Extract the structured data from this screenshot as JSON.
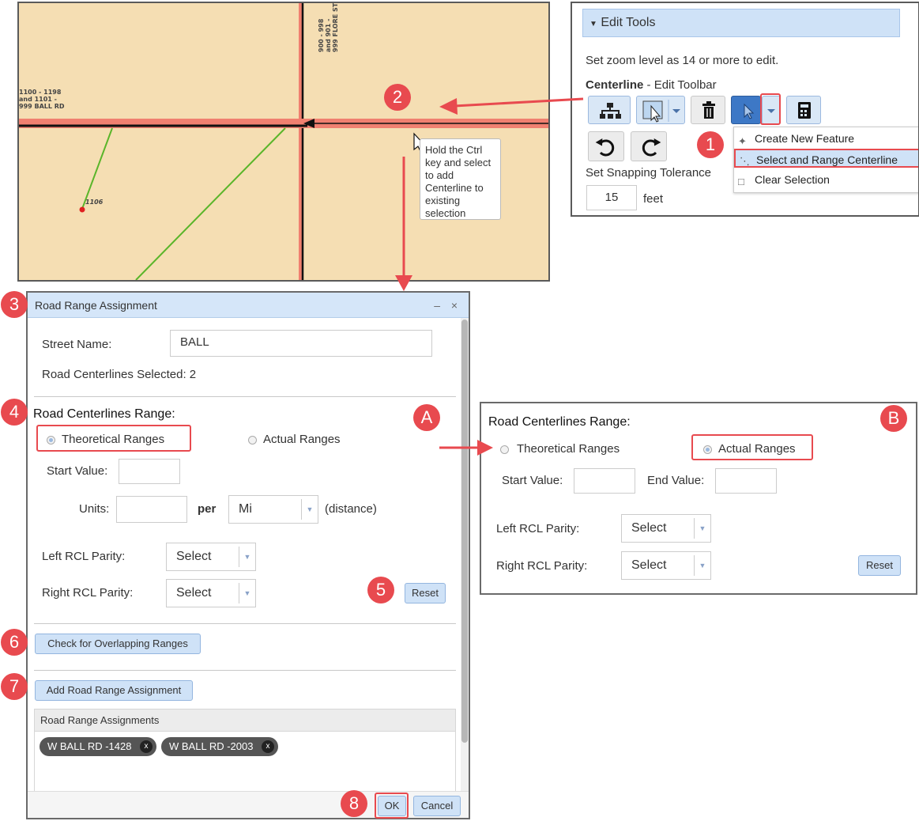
{
  "map": {
    "labels": {
      "ball_range": "1100 - 1198\nand 1101 -\n999 BALL RD",
      "flore_range": "900 - 998\nand 901 -\n999 FLORE ST",
      "point_label": "1106"
    },
    "tooltip": "Hold the Ctrl key and select to add Centerline to existing selection"
  },
  "edit_tools": {
    "header": "Edit Tools",
    "zoom_note": "Set zoom level as 14 or more to edit.",
    "toolbar_title_bold": "Centerline",
    "toolbar_title_rest": " - Edit Toolbar",
    "snap_label": "Set Snapping Tolerance",
    "snap_value": "15",
    "snap_unit": "feet",
    "menu": {
      "create": "Create New Feature",
      "select_range": "Select and Range Centerline",
      "clear": "Clear Selection"
    }
  },
  "dialog": {
    "title": "Road Range Assignment",
    "street_name_label": "Street Name:",
    "street_name_value": "BALL",
    "selected_text": "Road Centerlines Selected: 2",
    "range_heading": "Road Centerlines Range:",
    "radio_theoretical": "Theoretical Ranges",
    "radio_actual": "Actual Ranges",
    "start_value_label": "Start Value:",
    "units_label": "Units:",
    "per_label": "per",
    "units_select": "Mi",
    "distance_label": "(distance)",
    "left_parity_label": "Left RCL Parity:",
    "right_parity_label": "Right RCL Parity:",
    "select_placeholder": "Select",
    "reset_label": "Reset",
    "check_overlap_label": "Check for Overlapping Ranges",
    "add_assignment_label": "Add Road Range Assignment",
    "assignments_header": "Road Range Assignments",
    "assignments": [
      "W BALL RD -1428",
      "W BALL RD -2003"
    ],
    "chip_close": "x",
    "ok_label": "OK",
    "cancel_label": "Cancel"
  },
  "panel_b": {
    "range_heading": "Road Centerlines Range:",
    "radio_theoretical": "Theoretical Ranges",
    "radio_actual": "Actual Ranges",
    "start_value_label": "Start Value:",
    "end_value_label": "End Value:",
    "left_parity_label": "Left RCL Parity:",
    "right_parity_label": "Right RCL Parity:",
    "select_placeholder": "Select",
    "reset_label": "Reset"
  },
  "badges": {
    "b1": "1",
    "b2": "2",
    "b3": "3",
    "b4": "4",
    "b5": "5",
    "b6": "6",
    "b7": "7",
    "b8": "8",
    "bA": "A",
    "bB": "B"
  },
  "colors": {
    "highlight": "#e84a4f",
    "road": "#f08070",
    "map_bg": "#f5deb3",
    "button_blue": "#cfe2f7"
  }
}
